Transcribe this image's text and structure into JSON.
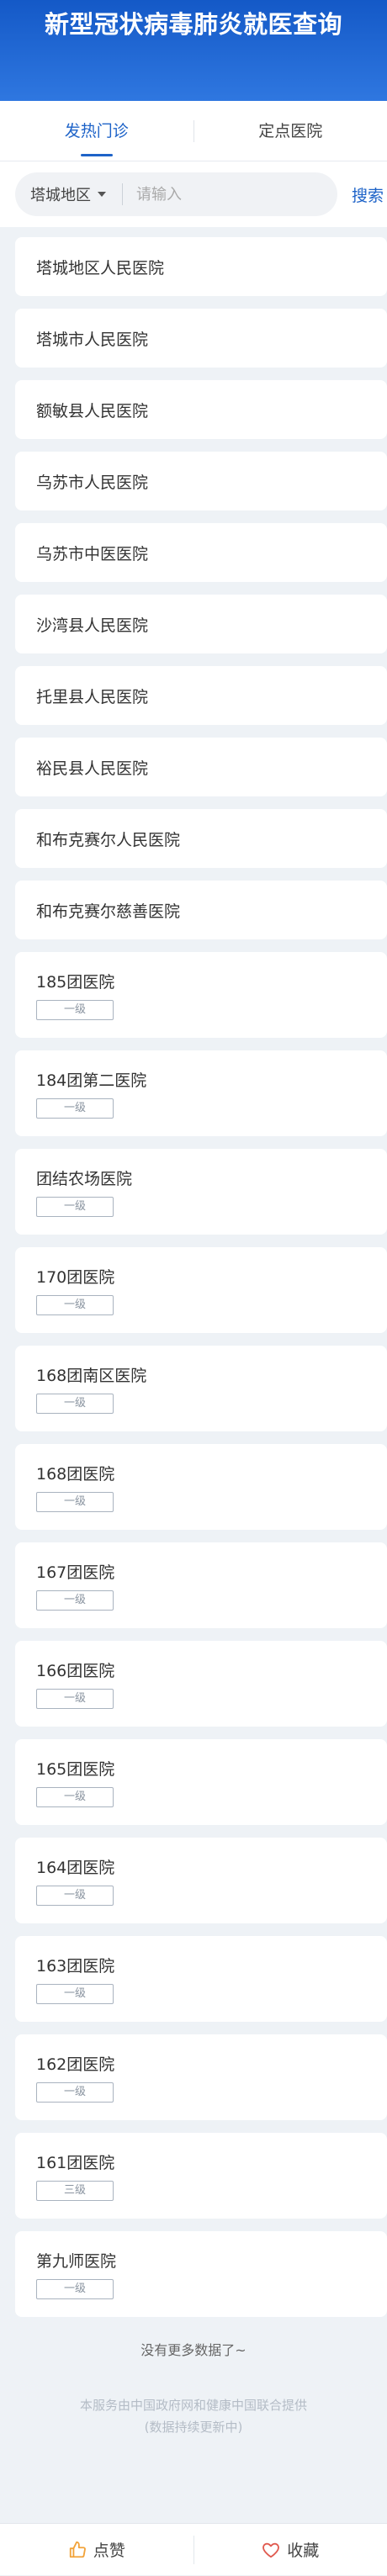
{
  "header": {
    "title": "新型冠状病毒肺炎就医查询"
  },
  "tabs": [
    {
      "label": "发热门诊",
      "active": true
    },
    {
      "label": "定点医院",
      "active": false
    }
  ],
  "search": {
    "region": "塔城地区",
    "placeholder": "请输入",
    "value": "",
    "button_label": "搜索"
  },
  "hospitals": [
    {
      "name": "塔城地区人民医院"
    },
    {
      "name": "塔城市人民医院"
    },
    {
      "name": "额敏县人民医院"
    },
    {
      "name": "乌苏市人民医院"
    },
    {
      "name": "乌苏市中医医院"
    },
    {
      "name": "沙湾县人民医院"
    },
    {
      "name": "托里县人民医院"
    },
    {
      "name": "裕民县人民医院"
    },
    {
      "name": "和布克赛尔人民医院"
    },
    {
      "name": "和布克赛尔慈善医院"
    },
    {
      "name": "185团医院",
      "level": "一级"
    },
    {
      "name": "184团第二医院",
      "level": "一级"
    },
    {
      "name": "团结农场医院",
      "level": "一级"
    },
    {
      "name": "170团医院",
      "level": "一级"
    },
    {
      "name": "168团南区医院",
      "level": "一级"
    },
    {
      "name": "168团医院",
      "level": "一级"
    },
    {
      "name": "167团医院",
      "level": "一级"
    },
    {
      "name": "166团医院",
      "level": "一级"
    },
    {
      "name": "165团医院",
      "level": "一级"
    },
    {
      "name": "164团医院",
      "level": "一级"
    },
    {
      "name": "163团医院",
      "level": "一级"
    },
    {
      "name": "162团医院",
      "level": "一级"
    },
    {
      "name": "161团医院",
      "level": "三级"
    },
    {
      "name": "第九师医院",
      "level": "一级"
    }
  ],
  "no_more_text": "没有更多数据了~",
  "footer_note": {
    "line1": "本服务由中国政府网和健康中国联合提供",
    "line2": "(数据持续更新中)"
  },
  "bottom_bar": {
    "like_label": "点赞",
    "like_icon": "thumbs-up-icon",
    "favorite_label": "收藏",
    "favorite_icon": "heart-icon"
  },
  "colors": {
    "header_blue": "#1459c7",
    "accent": "#1e63c8",
    "like_orange": "#f2a33a",
    "heart_red": "#e05a4f"
  }
}
